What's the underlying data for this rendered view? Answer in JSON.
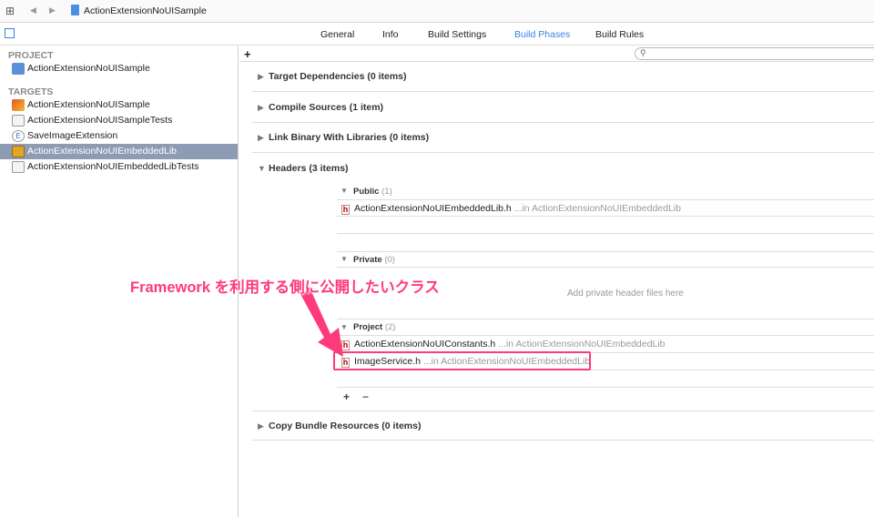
{
  "toolbar": {
    "title": "ActionExtensionNoUISample"
  },
  "tabs": [
    "General",
    "Info",
    "Build Settings",
    "Build Phases",
    "Build Rules"
  ],
  "active_tab": "Build Phases",
  "accent": "#3b82e0",
  "sidebar": {
    "project_header": "PROJECT",
    "project": "ActionExtensionNoUISample",
    "targets_header": "TARGETS",
    "targets": [
      "ActionExtensionNoUISample",
      "ActionExtensionNoUISampleTests",
      "SaveImageExtension",
      "ActionExtensionNoUIEmbeddedLib",
      "ActionExtensionNoUIEmbeddedLibTests"
    ],
    "selected": "ActionExtensionNoUIEmbeddedLib"
  },
  "add_label": "+",
  "phases": [
    "Target Dependencies (0 items)",
    "Compile Sources (1 item)",
    "Link Binary With Libraries (0 items)",
    "Headers (3 items)",
    "Copy Bundle Resources (0 items)"
  ],
  "headers": {
    "public": {
      "title": "Public",
      "count": "(1)",
      "files": [
        {
          "name": "ActionExtensionNoUIEmbeddedLib.h",
          "path": "...in ActionExtensionNoUIEmbeddedLib"
        }
      ]
    },
    "private": {
      "title": "Private",
      "count": "(0)",
      "placeholder": "Add private header files here"
    },
    "project": {
      "title": "Project",
      "count": "(2)",
      "files": [
        {
          "name": "ActionExtensionNoUIConstants.h",
          "path": "...in ActionExtensionNoUIEmbeddedLib"
        },
        {
          "name": "ImageService.h",
          "path": "...in ActionExtensionNoUIEmbeddedLib"
        }
      ]
    },
    "plus": "+",
    "minus": "−"
  },
  "annotation": {
    "text": "Framework を利用する側に公開したいクラス",
    "color": "#ff3a7a"
  }
}
